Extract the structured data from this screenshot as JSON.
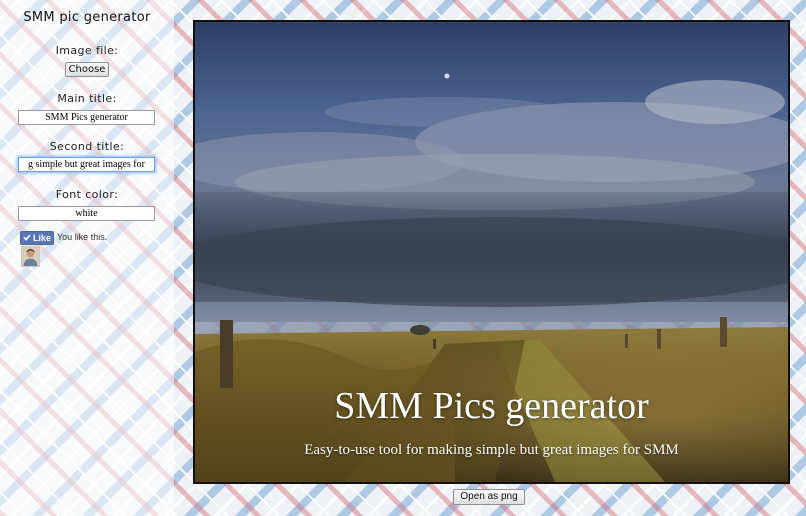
{
  "sidebar": {
    "app_title": "SMM pic generator",
    "image_file_label": "Image file:",
    "choose_button": "Choose",
    "main_title_label": "Main title:",
    "main_title_value": "SMM Pics generator",
    "second_title_label": "Second title:",
    "second_title_value": "g simple but great images for",
    "font_color_label": "Font color:",
    "font_color_value": "white",
    "like_button": "Like",
    "like_status": "You like this."
  },
  "canvas": {
    "main_title": "SMM Pics generator",
    "second_title": "Easy-to-use tool for making simple but great images for SMM",
    "text_color": "#ffffff"
  },
  "footer": {
    "open_png_button": "Open as png"
  },
  "colors": {
    "facebook_blue": "#5a77b5",
    "focus_ring": "#8cbaf0"
  },
  "icons": {
    "like": "thumbs-up-icon"
  }
}
